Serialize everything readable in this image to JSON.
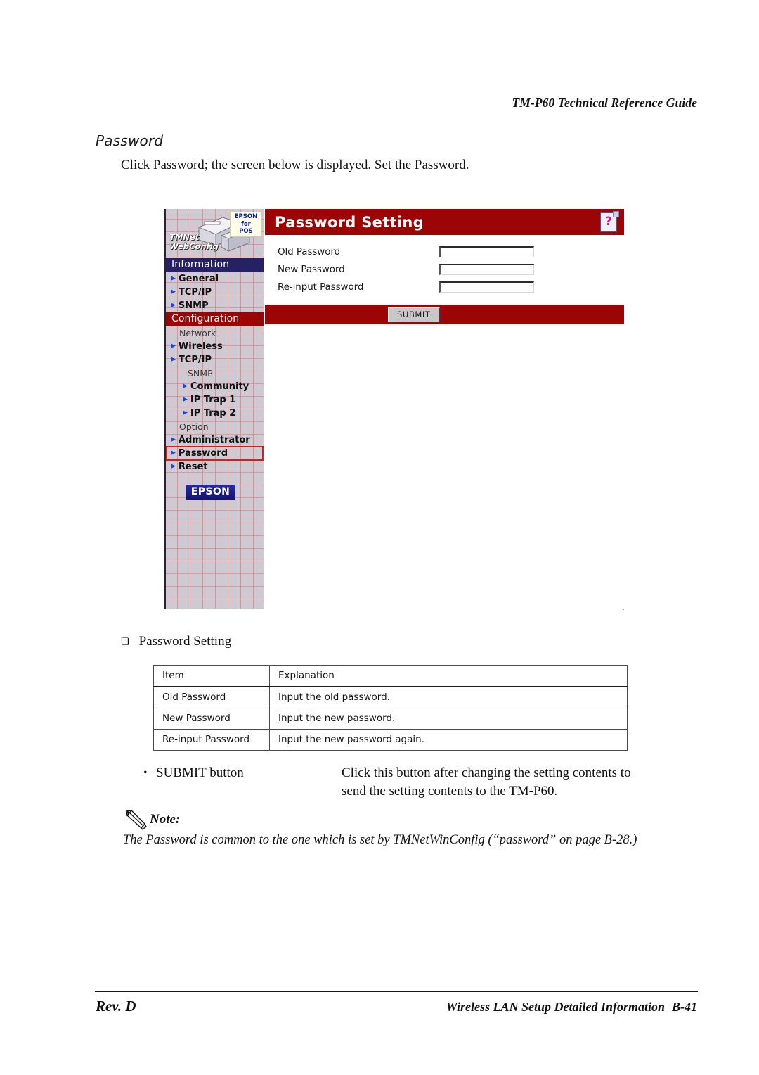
{
  "page": {
    "running_head": "TM-P60 Technical Reference Guide",
    "section_heading": "Password",
    "intro_paragraph": "Click Password; the screen below is displayed. Set the Password."
  },
  "screenshot": {
    "sidebar": {
      "brand": {
        "wordmark_line1": "TMNet",
        "wordmark_line2": "WebConfig",
        "badge_line1": "EPSON",
        "badge_line2": "for",
        "badge_line3": "POS"
      },
      "sections": [
        {
          "bar_label": "Information",
          "bar_color": "#262065",
          "entries": [
            {
              "type": "link",
              "label": "General",
              "level": 1,
              "selected": false
            },
            {
              "type": "link",
              "label": "TCP/IP",
              "level": 1,
              "selected": false
            },
            {
              "type": "link",
              "label": "SNMP",
              "level": 1,
              "selected": false
            }
          ]
        },
        {
          "bar_label": "Configuration",
          "bar_color": "#9c0505",
          "entries": [
            {
              "type": "group",
              "label": "Network",
              "level": 1
            },
            {
              "type": "link",
              "label": "Wireless",
              "level": 1,
              "selected": false
            },
            {
              "type": "link",
              "label": "TCP/IP",
              "level": 1,
              "selected": false
            },
            {
              "type": "group",
              "label": "SNMP",
              "level": 2
            },
            {
              "type": "link",
              "label": "Community",
              "level": 2,
              "selected": false
            },
            {
              "type": "link",
              "label": "IP Trap 1",
              "level": 2,
              "selected": false
            },
            {
              "type": "link",
              "label": "IP Trap 2",
              "level": 2,
              "selected": false
            },
            {
              "type": "group",
              "label": "Option",
              "level": 1
            },
            {
              "type": "link",
              "label": "Administrator",
              "level": 1,
              "selected": false
            },
            {
              "type": "link",
              "label": "Password",
              "level": 1,
              "selected": true
            },
            {
              "type": "link",
              "label": "Reset",
              "level": 1,
              "selected": false
            }
          ]
        }
      ],
      "footer_logo": "EPSON"
    },
    "content": {
      "title": "Password Setting",
      "help_glyph": "?",
      "fields": [
        {
          "label": "Old Password",
          "value": "",
          "placeholder": ""
        },
        {
          "label": "New Password",
          "value": "",
          "placeholder": ""
        },
        {
          "label": "Re-input Password",
          "value": "",
          "placeholder": ""
        }
      ],
      "submit_label": "SUBMIT"
    },
    "colors": {
      "title_bar": "#9c0505",
      "info_bar": "#262065",
      "selection_outline": "#e11b12",
      "sidebar_bg": "#cfc9d2"
    }
  },
  "bullet_heading": {
    "marker": "❑",
    "label": "Password Setting"
  },
  "spec_table": {
    "headers": [
      "Item",
      "Explanation"
    ],
    "rows": [
      [
        "Old Password",
        "Input the old password."
      ],
      [
        "New Password",
        "Input the new password."
      ],
      [
        "Re-input Password",
        "Input the new password again."
      ]
    ]
  },
  "submit_note": {
    "bullet": "•",
    "term": "SUBMIT button",
    "description_line1": "Click this button after changing the setting contents to",
    "description_line2": "send the setting contents to the TM-P60."
  },
  "note": {
    "label": "Note:",
    "text": "The Password is common to the one which is set by TMNetWinConfig (“password” on page B-28.)"
  },
  "footer": {
    "left": "Rev. D",
    "right": "Wireless LAN Setup Detailed Information",
    "page_number": "B-41"
  }
}
